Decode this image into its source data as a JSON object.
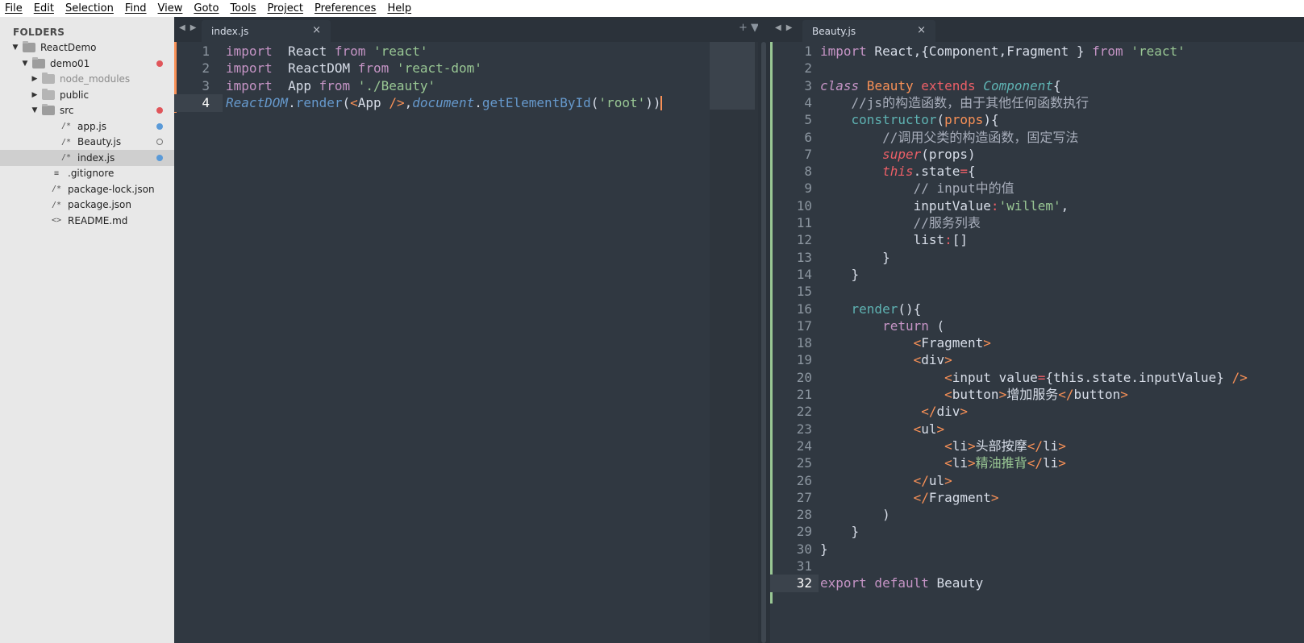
{
  "menu": [
    "File",
    "Edit",
    "Selection",
    "Find",
    "View",
    "Goto",
    "Tools",
    "Project",
    "Preferences",
    "Help"
  ],
  "sidebar": {
    "header": "FOLDERS",
    "items": [
      {
        "label": "ReactDemo",
        "type": "folder-open",
        "depth": 0,
        "arrow": "▼"
      },
      {
        "label": "demo01",
        "type": "folder-open",
        "depth": 1,
        "arrow": "▼",
        "dot": "red"
      },
      {
        "label": "node_modules",
        "type": "folder",
        "depth": 2,
        "arrow": "▶",
        "muted": true
      },
      {
        "label": "public",
        "type": "folder",
        "depth": 2,
        "arrow": "▶"
      },
      {
        "label": "src",
        "type": "folder-open",
        "depth": 2,
        "arrow": "▼",
        "dot": "red"
      },
      {
        "label": "app.js",
        "type": "file",
        "icon": "/*",
        "depth": 3,
        "dot": "blue"
      },
      {
        "label": "Beauty.js",
        "type": "file",
        "icon": "/*",
        "depth": 3,
        "dot": "ring"
      },
      {
        "label": "index.js",
        "type": "file",
        "icon": "/*",
        "depth": 3,
        "dot": "blue",
        "selected": true
      },
      {
        "label": ".gitignore",
        "type": "file",
        "icon": "≡",
        "depth": 2
      },
      {
        "label": "package-lock.json",
        "type": "file",
        "icon": "/*",
        "depth": 2
      },
      {
        "label": "package.json",
        "type": "file",
        "icon": "/*",
        "depth": 2
      },
      {
        "label": "README.md",
        "type": "file",
        "icon": "<>",
        "depth": 2
      }
    ]
  },
  "left_pane": {
    "tab": "index.js",
    "close": "×",
    "tools": "+ ▼",
    "lines": [
      [
        [
          "kw",
          "import"
        ],
        [
          "",
          "  React "
        ],
        [
          "kw",
          "from"
        ],
        [
          "",
          ""
        ],
        [
          "str",
          " 'react'"
        ]
      ],
      [
        [
          "kw",
          "import"
        ],
        [
          "",
          ""
        ],
        [
          "",
          ""
        ],
        [
          "",
          "  ReactDOM "
        ],
        [
          "kw",
          "from"
        ],
        [
          "str",
          " 'react-dom'"
        ]
      ],
      [
        [
          "kw",
          "import"
        ],
        [
          "",
          "  App "
        ],
        [
          "kw",
          "from"
        ],
        [
          "str",
          " './Beauty'"
        ]
      ],
      [
        [
          "fn it",
          "ReactDOM"
        ],
        [
          "",
          "."
        ],
        [
          "fn",
          "render"
        ],
        [
          "",
          "("
        ],
        [
          "tagp",
          "<"
        ],
        [
          "",
          "App "
        ],
        [
          "tagp",
          "/>"
        ],
        [
          "",
          ","
        ],
        [
          "fn it",
          "document"
        ],
        [
          "",
          "."
        ],
        [
          "fn",
          "getElementById"
        ],
        [
          "",
          "("
        ],
        [
          "str",
          "'root'"
        ],
        [
          "",
          "))"
        ]
      ]
    ]
  },
  "right_pane": {
    "tab": "Beauty.js",
    "close": "×",
    "lines": [
      [
        [
          "kw",
          "import"
        ],
        [
          "",
          " React,{Component,Fragment } "
        ],
        [
          "kw",
          "from"
        ],
        [
          "str",
          " 'react'"
        ]
      ],
      [],
      [
        [
          "kw it",
          "class"
        ],
        [
          "cls",
          " Beauty "
        ],
        [
          "red",
          "extends"
        ],
        [
          "cy it",
          " Component"
        ],
        [
          "",
          "{"
        ]
      ],
      [
        [
          "",
          "    "
        ],
        [
          "cmt",
          "//js的构造函数，由于其他任何函数执行"
        ]
      ],
      [
        [
          "",
          "    "
        ],
        [
          "cy",
          "constructor"
        ],
        [
          "",
          "("
        ],
        [
          "cls",
          "props"
        ],
        [
          "",
          "){"
        ]
      ],
      [
        [
          "",
          "        "
        ],
        [
          "cmt",
          "//调用父类的构造函数，固定写法"
        ]
      ],
      [
        [
          "",
          "        "
        ],
        [
          "red it",
          "super"
        ],
        [
          "",
          "(props)"
        ]
      ],
      [
        [
          "",
          "        "
        ],
        [
          "red it",
          "this"
        ],
        [
          "",
          ".state"
        ],
        [
          "red",
          "="
        ],
        [
          "",
          "{"
        ]
      ],
      [
        [
          "",
          "            "
        ],
        [
          "cmt",
          "// input中的值"
        ]
      ],
      [
        [
          "",
          "            inputValue"
        ],
        [
          "red",
          ":"
        ],
        [
          "str",
          "'willem'"
        ],
        [
          "",
          ","
        ]
      ],
      [
        [
          "",
          "            "
        ],
        [
          "cmt",
          "//服务列表"
        ]
      ],
      [
        [
          "",
          "            list"
        ],
        [
          "red",
          ":"
        ],
        [
          "",
          "[]"
        ]
      ],
      [
        [
          "",
          "        }"
        ]
      ],
      [
        [
          "",
          "    }"
        ]
      ],
      [],
      [
        [
          "",
          "    "
        ],
        [
          "cy",
          "render"
        ],
        [
          "",
          "(){"
        ]
      ],
      [
        [
          "",
          "        "
        ],
        [
          "kw",
          "return"
        ],
        [
          "",
          " ("
        ]
      ],
      [
        [
          "",
          "            "
        ],
        [
          "tagp",
          "<"
        ],
        [
          "",
          "Fragment"
        ],
        [
          "tagp",
          ">"
        ]
      ],
      [
        [
          "",
          "            "
        ],
        [
          "tagp",
          "<"
        ],
        [
          "",
          "div"
        ],
        [
          "tagp",
          ">"
        ]
      ],
      [
        [
          "",
          "                "
        ],
        [
          "tagp",
          "<"
        ],
        [
          "",
          "input value"
        ],
        [
          "red",
          "="
        ],
        [
          "",
          "{this.state.inputValue} "
        ],
        [
          "tagp",
          "/>"
        ]
      ],
      [
        [
          "",
          "                "
        ],
        [
          "tagp",
          "<"
        ],
        [
          "",
          "button"
        ],
        [
          "tagp",
          ">"
        ],
        [
          "",
          "增加服务"
        ],
        [
          "tagp",
          "</"
        ],
        [
          "",
          "button"
        ],
        [
          "tagp",
          ">"
        ]
      ],
      [
        [
          "",
          "             "
        ],
        [
          "tagp",
          "</"
        ],
        [
          "",
          "div"
        ],
        [
          "tagp",
          ">"
        ]
      ],
      [
        [
          "",
          "            "
        ],
        [
          "tagp",
          "<"
        ],
        [
          "",
          "ul"
        ],
        [
          "tagp",
          ">"
        ]
      ],
      [
        [
          "",
          "                "
        ],
        [
          "tagp",
          "<"
        ],
        [
          "",
          "li"
        ],
        [
          "tagp",
          ">"
        ],
        [
          "",
          "头部按摩"
        ],
        [
          "tagp",
          "</"
        ],
        [
          "",
          "li"
        ],
        [
          "tagp",
          ">"
        ]
      ],
      [
        [
          "",
          "                "
        ],
        [
          "tagp",
          "<"
        ],
        [
          "",
          "li"
        ],
        [
          "tagp",
          ">"
        ],
        [
          "str",
          "精油推背"
        ],
        [
          "tagp",
          "</"
        ],
        [
          "",
          "li"
        ],
        [
          "tagp",
          ">"
        ]
      ],
      [
        [
          "",
          "            "
        ],
        [
          "tagp",
          "</"
        ],
        [
          "",
          "ul"
        ],
        [
          "tagp",
          ">"
        ]
      ],
      [
        [
          "",
          "            "
        ],
        [
          "tagp",
          "</"
        ],
        [
          "",
          "Fragment"
        ],
        [
          "tagp",
          ">"
        ]
      ],
      [
        [
          "",
          "        )"
        ]
      ],
      [
        [
          "",
          "    }"
        ]
      ],
      [
        [
          "",
          "}"
        ]
      ],
      [],
      [
        [
          "kw",
          "export"
        ],
        [
          "",
          ""
        ],
        [
          "kw",
          " default"
        ],
        [
          "",
          " Beauty"
        ]
      ]
    ]
  }
}
